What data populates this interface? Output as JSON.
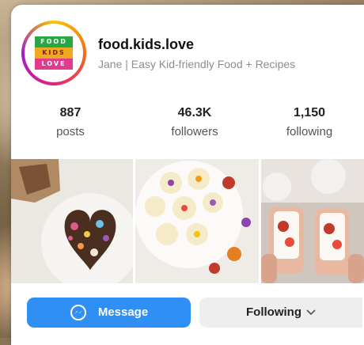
{
  "profile": {
    "username": "food.kids.love",
    "bio": "Jane | Easy Kid-friendly Food + Recipes",
    "avatar_text": [
      "FOOD",
      "KIDS",
      "LOVE"
    ],
    "avatar_colors": [
      "#28a745",
      "#f0a81f",
      "#e23a8d"
    ]
  },
  "stats": [
    {
      "value": "887",
      "label": "posts"
    },
    {
      "value": "46.3K",
      "label": "followers"
    },
    {
      "value": "1,150",
      "label": "following"
    }
  ],
  "photos": [
    {
      "icon": "chocolate-bark-hearts-photo"
    },
    {
      "icon": "banana-slices-flowers-photo"
    },
    {
      "icon": "strawberry-crepe-roll-photo"
    }
  ],
  "actions": {
    "message_label": "Message",
    "following_label": "Following",
    "accent": "#2f8ff5"
  }
}
